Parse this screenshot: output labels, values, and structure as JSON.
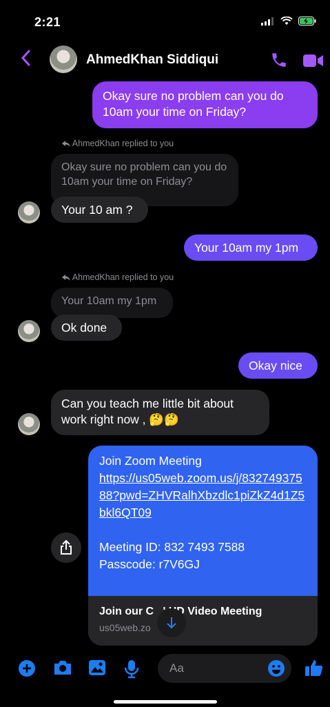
{
  "status_bar": {
    "time": "2:21"
  },
  "header": {
    "contact_name": "AhmedKhan Siddiqui"
  },
  "colors": {
    "accent": "#a259ff",
    "outgoing": "#6a4cf4",
    "link_blue": "#2f63f0",
    "incoming": "#262628"
  },
  "messages": {
    "m1": "Okay sure no problem can you do 10am your time on Friday?",
    "reply1_label": "AhmedKhan replied to you",
    "reply1_quote": "Okay sure no problem can you do 10am your time on Friday?",
    "m2": "Your 10 am ?",
    "m3": "Your 10am my 1pm",
    "reply2_label": "AhmedKhan replied to you",
    "reply2_quote": "Your 10am my 1pm",
    "m4": "Ok done",
    "m5": "Okay nice",
    "m6": "Can you teach me little bit about work right now , 🤔🤔"
  },
  "zoom": {
    "line1": "Join Zoom Meeting",
    "link": "https://us05web.zoom.us/j/83274937588?pwd=ZHVRalhXbzdlc1piZkZ4d1Z5bkl6QT09",
    "meeting_id": "Meeting ID: 832 7493 7588",
    "passcode": "Passcode: r7V6GJ",
    "preview_title": "Join our C   ' HD Video Meeting",
    "preview_url": "us05web.zo         ."
  },
  "composer": {
    "placeholder": "Aa"
  }
}
